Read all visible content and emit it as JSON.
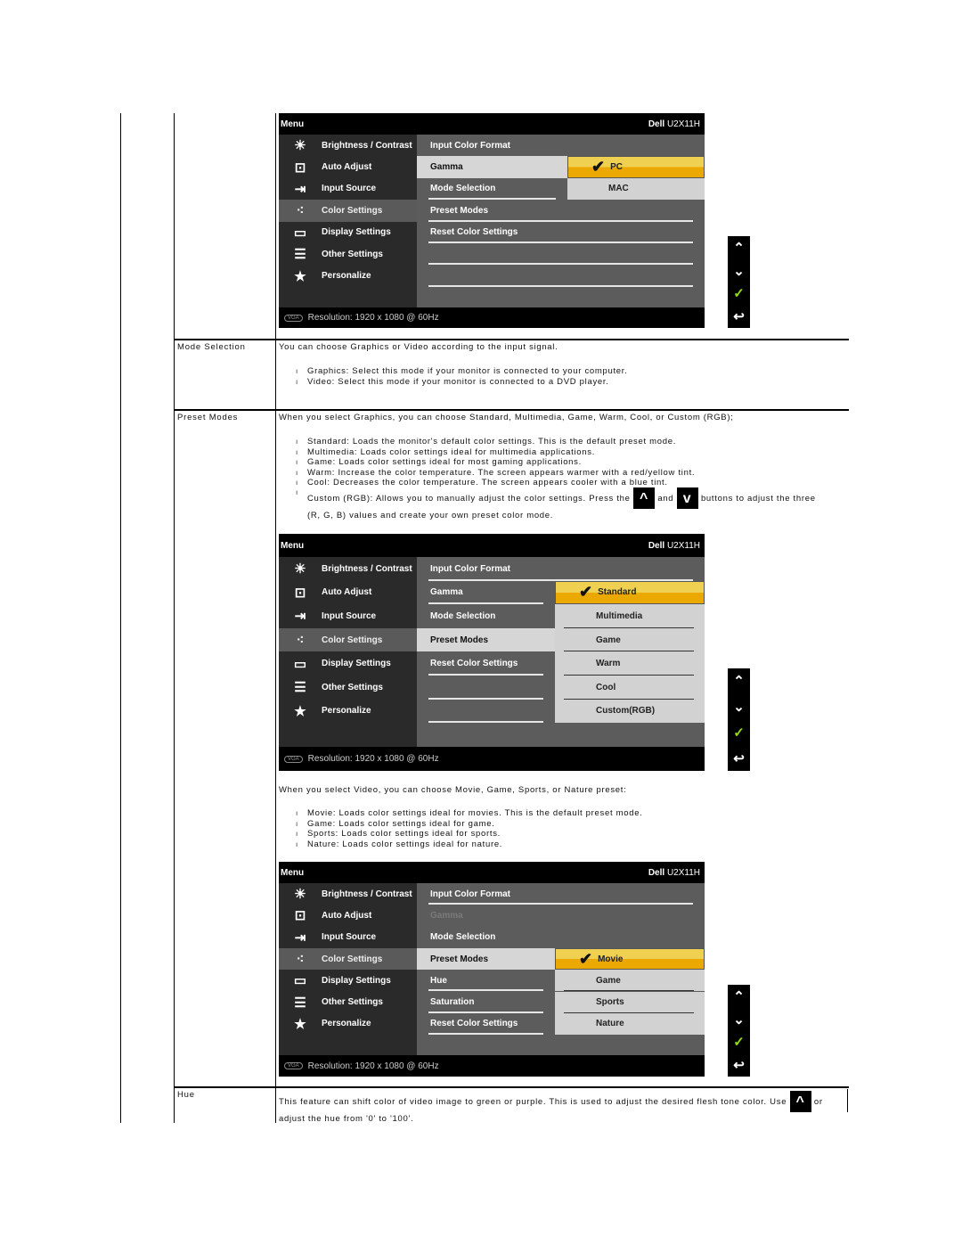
{
  "menu_items": [
    {
      "label": "Brightness / Contrast",
      "icon": "brightness-icon",
      "glyph": "☀"
    },
    {
      "label": "Auto Adjust",
      "icon": "auto-adjust-icon",
      "glyph": "⊡"
    },
    {
      "label": "Input Source",
      "icon": "input-source-icon",
      "glyph": "⇥"
    },
    {
      "label": "Color Settings",
      "icon": "color-settings-icon",
      "glyph": "⁖"
    },
    {
      "label": "Display Settings",
      "icon": "display-settings-icon",
      "glyph": "▭"
    },
    {
      "label": "Other Settings",
      "icon": "other-settings-icon",
      "glyph": "☰"
    },
    {
      "label": "Personalize",
      "icon": "star-icon",
      "glyph": "★"
    }
  ],
  "osd_common": {
    "menu_title": "Menu",
    "brand": "Dell",
    "model": "U2X11H",
    "resolution": "Resolution: 1920 x 1080 @ 60Hz",
    "selected_menu": "Color Settings"
  },
  "osds": [
    {
      "sub": [
        {
          "label": "Input Color Format",
          "state": "normal"
        },
        {
          "label": "Gamma",
          "state": "active"
        },
        {
          "label": "Mode Selection",
          "state": "line"
        },
        {
          "label": "Preset Modes",
          "state": "line"
        },
        {
          "label": "Reset Color Settings",
          "state": "line"
        },
        {
          "label": "",
          "state": "line"
        },
        {
          "label": "",
          "state": "line"
        }
      ],
      "options": [
        {
          "label": "PC",
          "selected": true
        },
        {
          "label": "MAC",
          "selected": false
        }
      ],
      "options_start_row": 1
    },
    {
      "sub": [
        {
          "label": "Input Color Format",
          "state": "line"
        },
        {
          "label": "Gamma",
          "state": "line"
        },
        {
          "label": "Mode Selection",
          "state": "normal"
        },
        {
          "label": "Preset Modes",
          "state": "active"
        },
        {
          "label": "Reset Color Settings",
          "state": "line"
        },
        {
          "label": "",
          "state": "line"
        },
        {
          "label": "",
          "state": "line"
        }
      ],
      "options": [
        {
          "label": "Standard",
          "selected": true
        },
        {
          "label": "Multimedia",
          "selected": false
        },
        {
          "label": "Game",
          "selected": false
        },
        {
          "label": "Warm",
          "selected": false
        },
        {
          "label": "Cool",
          "selected": false
        },
        {
          "label": "Custom(RGB)",
          "selected": false
        }
      ],
      "options_start_row": 1
    },
    {
      "sub": [
        {
          "label": "Input Color Format",
          "state": "line"
        },
        {
          "label": "Gamma",
          "state": "disabled"
        },
        {
          "label": "Mode Selection",
          "state": "normal"
        },
        {
          "label": "Preset Modes",
          "state": "active"
        },
        {
          "label": "Hue",
          "state": "line"
        },
        {
          "label": "Saturation",
          "state": "line"
        },
        {
          "label": "Reset Color Settings",
          "state": "line"
        }
      ],
      "options": [
        {
          "label": "Movie",
          "selected": true
        },
        {
          "label": "Game",
          "selected": false
        },
        {
          "label": "Sports",
          "selected": false
        },
        {
          "label": "Nature",
          "selected": false
        }
      ],
      "options_start_row": 3
    }
  ],
  "nav_buttons": [
    {
      "name": "up-button",
      "glyph": "⌃"
    },
    {
      "name": "down-button",
      "glyph": "⌄"
    },
    {
      "name": "ok-check-button",
      "glyph": "✓"
    },
    {
      "name": "back-button",
      "glyph": "↩"
    }
  ],
  "colors": {
    "selected_option_top": "#f0d050",
    "selected_option_bottom": "#eaa800",
    "check_green": "#8edc1a"
  },
  "rows": {
    "mode_selection": {
      "label": "Mode Selection",
      "intro": "You can choose Graphics or Video according to the input signal.",
      "bullets": [
        "Graphics: Select this mode if your monitor is connected to your computer.",
        "Video: Select this mode if your monitor is connected to a DVD player."
      ]
    },
    "preset_modes": {
      "label": "Preset Modes",
      "intro": "When you select Graphics, you can choose Standard, Multimedia, Game, Warm, Cool, or Custom (RGB);",
      "bullets": [
        "Standard: Loads the monitor's default color settings. This is the default preset mode.",
        "Multimedia: Loads color settings ideal for multimedia applications.",
        "Game: Loads color settings ideal for most gaming applications.",
        "Warm: Increase the color temperature. The screen appears warmer with a red/yellow tint.",
        "Cool: Decreases the color temperature. The screen appears cooler with a blue tint."
      ],
      "custom_a": "Custom (RGB): Allows you to manually adjust the color settings. Press the",
      "custom_and": "and",
      "custom_b": "buttons to adjust the three",
      "custom_c": "(R, G, B) values and create your own preset color mode.",
      "video_intro": "When you select Video, you can choose Movie, Game, Sports, or Nature preset:",
      "video_bullets": [
        "Movie: Loads color settings ideal for movies. This is the default preset mode.",
        "Game: Loads color settings ideal for game.",
        "Sports: Loads color settings ideal for sports.",
        "Nature: Loads color settings ideal for nature."
      ]
    },
    "hue": {
      "label": "Hue",
      "text_a": "This feature can shift color of video image to green or purple. This is used to adjust the desired flesh tone color. Use",
      "text_or": "or",
      "text_b": "adjust the hue from '0' to '100'."
    }
  }
}
